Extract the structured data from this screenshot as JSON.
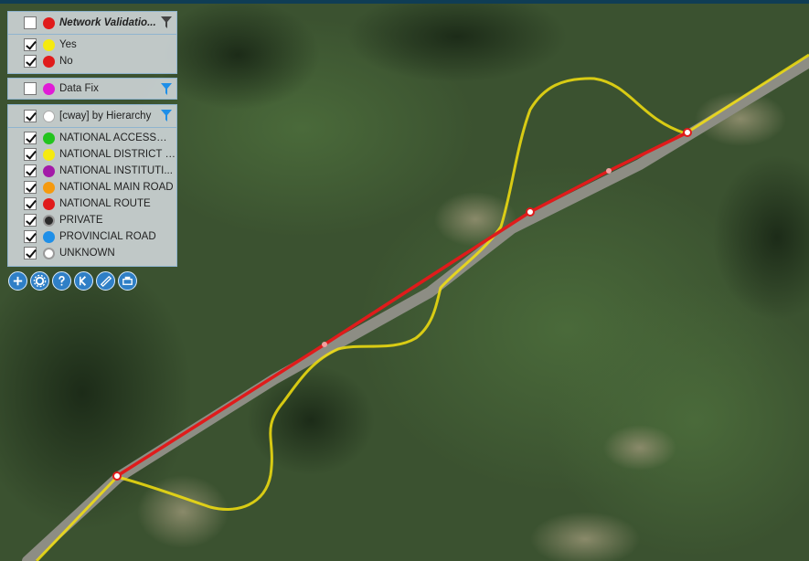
{
  "validation_panel": {
    "title": "Network Validatio...",
    "title_dot_color": "#e01b1b",
    "items": [
      {
        "label": "Yes",
        "color": "#f5ea0f",
        "checked": true
      },
      {
        "label": "No",
        "color": "#e01b1b",
        "checked": true
      }
    ]
  },
  "datafix_panel": {
    "title": "Data Fix",
    "dot_color": "#e01bd6",
    "checked": false
  },
  "hierarchy_panel": {
    "title": "[cway] by Hierarchy",
    "dot_color": "#ffffff",
    "checked": true,
    "items": [
      {
        "label": "NATIONAL ACCESSWAY",
        "color": "#22c41e",
        "checked": true
      },
      {
        "label": "NATIONAL DISTRICT R...",
        "color": "#f5ea0f",
        "checked": true
      },
      {
        "label": "NATIONAL INSTITUTI...",
        "color": "#a31aa8",
        "checked": true
      },
      {
        "label": "NATIONAL MAIN ROAD",
        "color": "#f59a0f",
        "checked": true
      },
      {
        "label": "NATIONAL ROUTE",
        "color": "#e01b1b",
        "checked": true
      },
      {
        "label": "PRIVATE",
        "color": "#2b2b2b",
        "checked": true
      },
      {
        "label": "PROVINCIAL ROAD",
        "color": "#1e8fe8",
        "checked": true
      },
      {
        "label": "UNKNOWN",
        "color": "#ffffff",
        "checked": true
      }
    ]
  },
  "toolbar": {
    "icons": [
      "add-icon",
      "settings-icon",
      "help-icon",
      "back-icon",
      "ruler-icon",
      "print-icon"
    ]
  },
  "map": {
    "route_color": "#e01b1b",
    "district_road_color": "#f5e10f"
  }
}
